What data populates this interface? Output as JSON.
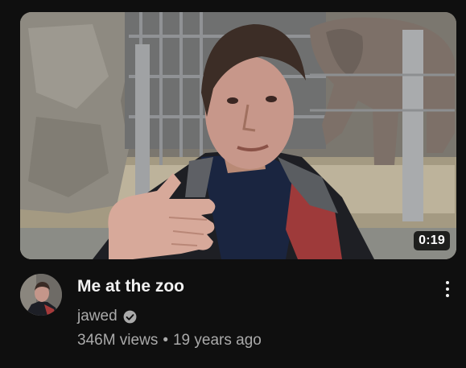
{
  "video": {
    "title": "Me at the zoo",
    "duration": "0:19",
    "channel": "jawed",
    "views": "346M views",
    "separator": "•",
    "age": "19 years ago"
  },
  "icons": {
    "verified": "verified-check-icon",
    "menu": "more-vert-icon"
  },
  "colors": {
    "background": "#0f0f0f",
    "title": "#f1f1f1",
    "secondary_text": "#aaaaaa"
  }
}
